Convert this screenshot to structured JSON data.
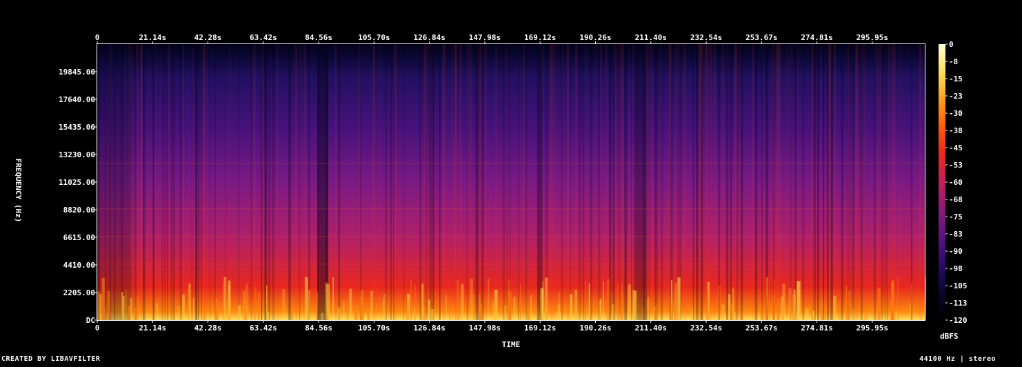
{
  "chart_data": {
    "type": "heatmap",
    "xlabel": "TIME",
    "ylabel": "FREQUENCY (Hz)",
    "x_ticks": [
      "0",
      "21.14s",
      "42.28s",
      "63.42s",
      "84.56s",
      "105.70s",
      "126.84s",
      "147.98s",
      "169.12s",
      "190.26s",
      "211.40s",
      "232.54s",
      "253.67s",
      "274.81s",
      "295.95s"
    ],
    "x_tick_values": [
      0,
      21.14,
      42.28,
      63.42,
      84.56,
      105.7,
      126.84,
      147.98,
      169.12,
      190.26,
      211.4,
      232.54,
      253.67,
      274.81,
      295.95
    ],
    "xlim": [
      0,
      316.0
    ],
    "y_ticks": [
      "DC",
      "2205.00",
      "4410.00",
      "6615.00",
      "8820.00",
      "11025.00",
      "13230.00",
      "15435.00",
      "17640.00",
      "19845.00"
    ],
    "y_tick_values": [
      0,
      2205,
      4410,
      6615,
      8820,
      11025,
      13230,
      15435,
      17640,
      19845
    ],
    "ylim": [
      0,
      22050
    ],
    "colorbar": {
      "label": "dBFS",
      "ticks": [
        "0",
        "-8",
        "-15",
        "-23",
        "-30",
        "-38",
        "-45",
        "-53",
        "-60",
        "-68",
        "-75",
        "-83",
        "-90",
        "-98",
        "-105",
        "-113",
        "-120"
      ],
      "range": [
        -120,
        0
      ]
    },
    "colormap": [
      "#000000",
      "#0a0530",
      "#2a0a6a",
      "#5a1282",
      "#8a1a7a",
      "#c0205a",
      "#e8281e",
      "#ff5a0a",
      "#ffa01e",
      "#ffe060",
      "#ffffd0"
    ]
  },
  "footer": {
    "created_by": "CREATED BY LIBAVFILTER",
    "info": "44100 Hz | stereo"
  }
}
